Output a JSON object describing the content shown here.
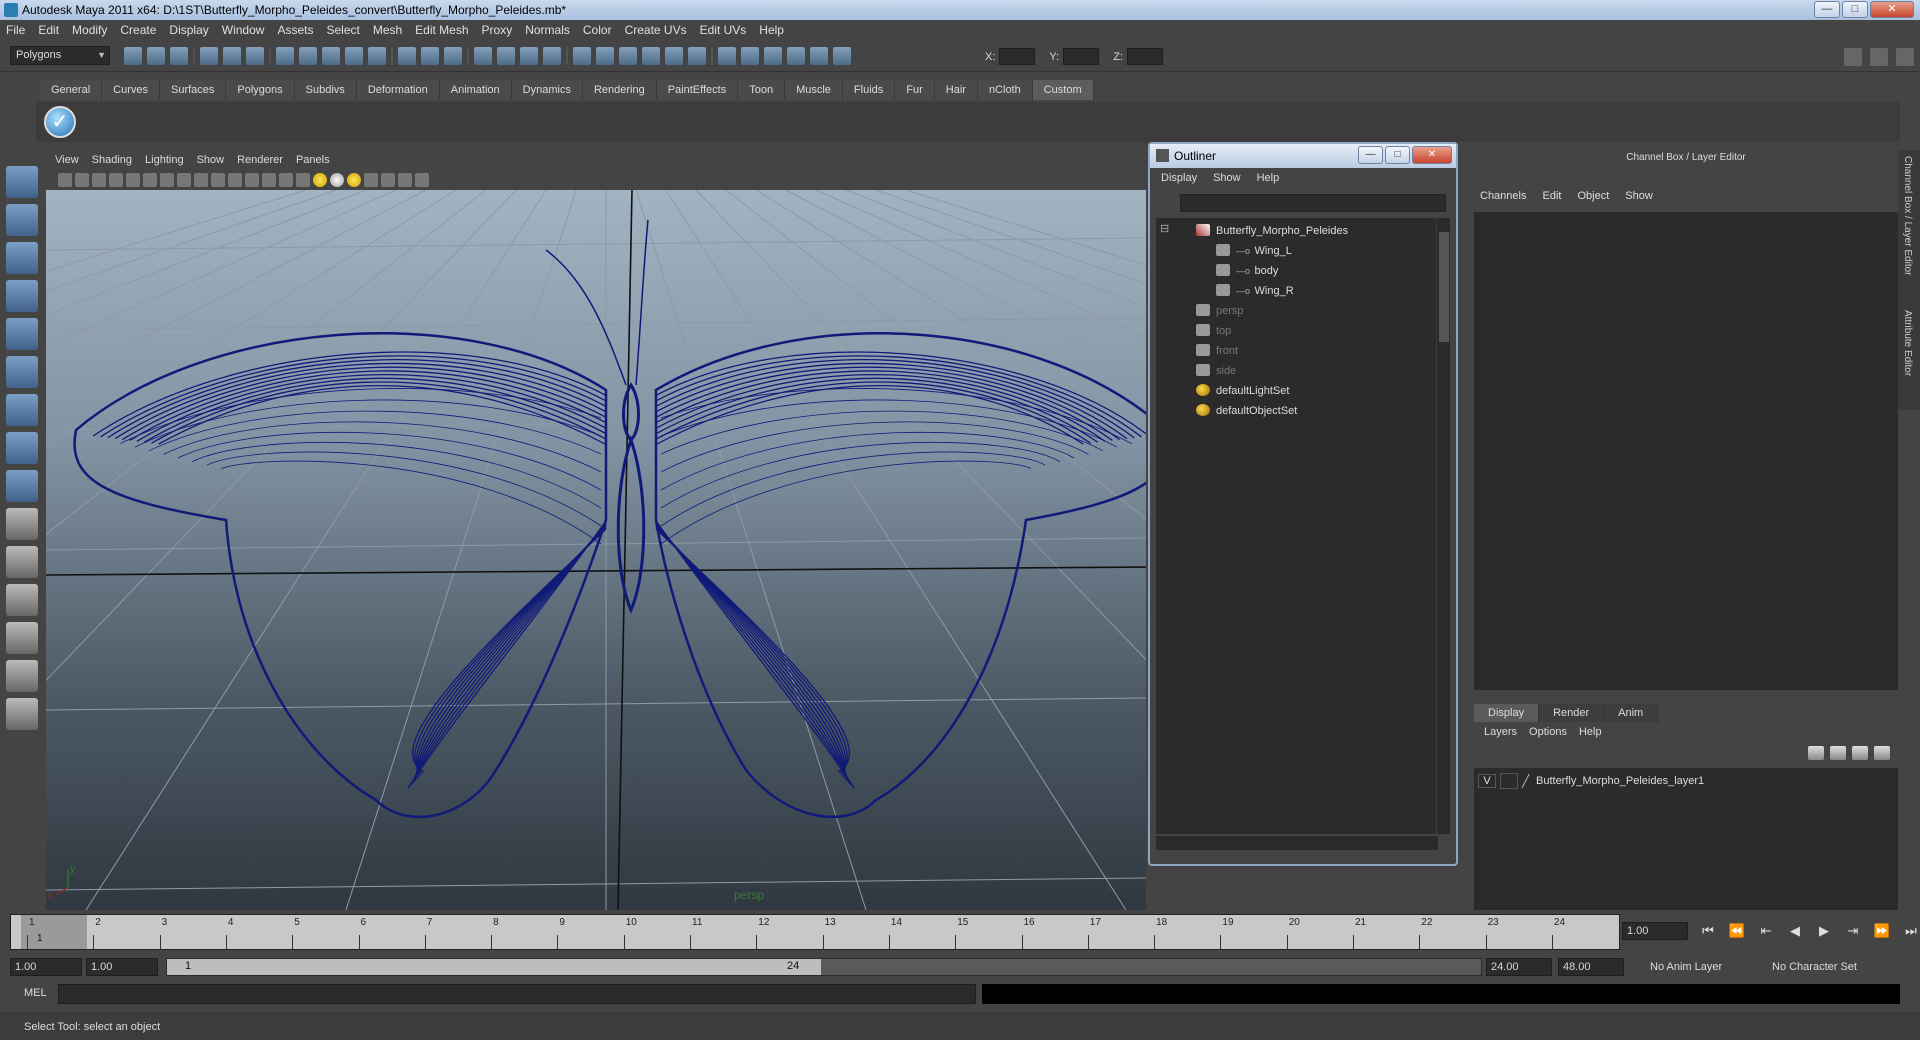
{
  "window": {
    "title": "Autodesk Maya 2011 x64: D:\\1ST\\Butterfly_Morpho_Peleides_convert\\Butterfly_Morpho_Peleides.mb*"
  },
  "menubar": [
    "File",
    "Edit",
    "Modify",
    "Create",
    "Display",
    "Window",
    "Assets",
    "Select",
    "Mesh",
    "Edit Mesh",
    "Proxy",
    "Normals",
    "Color",
    "Create UVs",
    "Edit UVs",
    "Help"
  ],
  "toolbar": {
    "mode": "Polygons",
    "x_label": "X:",
    "y_label": "Y:",
    "z_label": "Z:"
  },
  "shelf": {
    "tabs": [
      "General",
      "Curves",
      "Surfaces",
      "Polygons",
      "Subdivs",
      "Deformation",
      "Animation",
      "Dynamics",
      "Rendering",
      "PaintEffects",
      "Toon",
      "Muscle",
      "Fluids",
      "Fur",
      "Hair",
      "nCloth",
      "Custom"
    ],
    "active": "Custom"
  },
  "viewport": {
    "menu": [
      "View",
      "Shading",
      "Lighting",
      "Show",
      "Renderer",
      "Panels"
    ],
    "camera": "persp",
    "axis_y": "y",
    "axis_x": "x"
  },
  "outliner": {
    "title": "Outliner",
    "menu": [
      "Display",
      "Show",
      "Help"
    ],
    "items": [
      {
        "label": "Butterfly_Morpho_Peleides",
        "depth": 0,
        "dim": false,
        "icon": "transform"
      },
      {
        "label": "Wing_L",
        "depth": 1,
        "dim": false,
        "icon": "mesh"
      },
      {
        "label": "body",
        "depth": 1,
        "dim": false,
        "icon": "mesh"
      },
      {
        "label": "Wing_R",
        "depth": 1,
        "dim": false,
        "icon": "mesh"
      },
      {
        "label": "persp",
        "depth": 0,
        "dim": true,
        "icon": "camera"
      },
      {
        "label": "top",
        "depth": 0,
        "dim": true,
        "icon": "camera"
      },
      {
        "label": "front",
        "depth": 0,
        "dim": true,
        "icon": "camera"
      },
      {
        "label": "side",
        "depth": 0,
        "dim": true,
        "icon": "camera"
      },
      {
        "label": "defaultLightSet",
        "depth": 0,
        "dim": false,
        "icon": "set"
      },
      {
        "label": "defaultObjectSet",
        "depth": 0,
        "dim": false,
        "icon": "set"
      }
    ]
  },
  "channel_box": {
    "title": "Channel Box / Layer Editor",
    "menu": [
      "Channels",
      "Edit",
      "Object",
      "Show"
    ]
  },
  "layer_editor": {
    "tabs": [
      "Display",
      "Render",
      "Anim"
    ],
    "active": "Display",
    "menu": [
      "Layers",
      "Options",
      "Help"
    ],
    "layers": [
      {
        "visible": "V",
        "name": "Butterfly_Morpho_Peleides_layer1"
      }
    ]
  },
  "side_tabs": [
    "Channel Box / Layer Editor",
    "Attribute Editor"
  ],
  "timeline": {
    "start": 1,
    "end": 24,
    "current": "1.00"
  },
  "range": {
    "start": "1.00",
    "playback_start": "1.00",
    "slider_start": "1",
    "slider_end": "24",
    "playback_end": "24.00",
    "end": "48.00",
    "anim_layer": "No Anim Layer",
    "character_set": "No Character Set"
  },
  "command": {
    "label": "MEL"
  },
  "helpline": "Select Tool: select an object"
}
